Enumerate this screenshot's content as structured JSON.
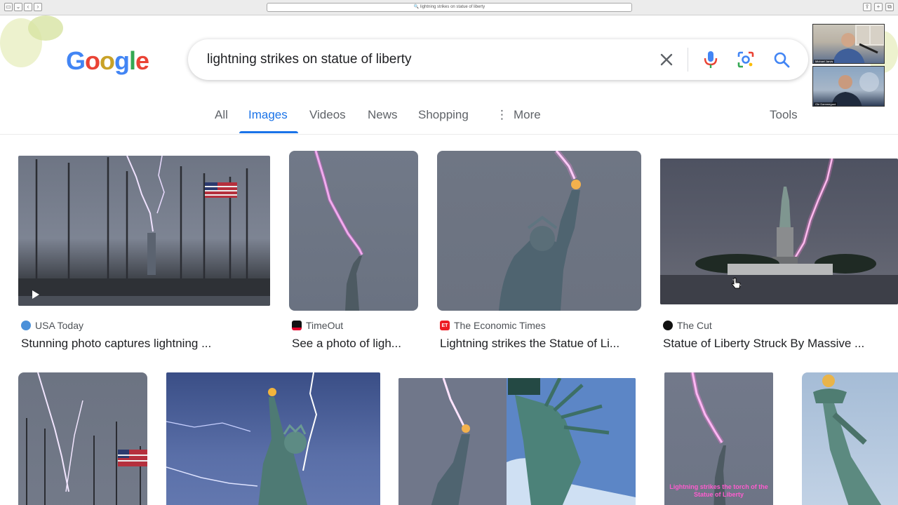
{
  "browser": {
    "address": "🔍 lightning strikes on statue of liberty"
  },
  "logo": {
    "letters": [
      "G",
      "o",
      "o",
      "g",
      "l",
      "e"
    ],
    "colors": [
      "#4285f4",
      "#ea4335",
      "#fbbc05",
      "#4285f4",
      "#34a853",
      "#ea4335"
    ]
  },
  "search": {
    "query": "lightning strikes on statue of liberty"
  },
  "tabs": [
    {
      "label": "All"
    },
    {
      "label": "Images"
    },
    {
      "label": "Videos"
    },
    {
      "label": "News"
    },
    {
      "label": "Shopping"
    },
    {
      "label": "More"
    }
  ],
  "tools_label": "Tools",
  "webcam": {
    "top_name": "Michael Jarvis",
    "bottom_name": "Ole Dammegard"
  },
  "results": [
    {
      "source": "USA Today",
      "title": "Stunning photo captures lightning ...",
      "favicon_color": "#4a90d9"
    },
    {
      "source": "TimeOut",
      "title": "See a photo of ligh...",
      "favicon_color": "#e4002b"
    },
    {
      "source": "The Economic Times",
      "title": "Lightning strikes the Statue of Li...",
      "favicon_color": "#ed1c24",
      "favicon_text": "ET"
    },
    {
      "source": "The Cut",
      "title": "Statue of Liberty Struck By Massive ...",
      "favicon_color": "#111111"
    }
  ],
  "row2_caption": "Lightning strikes the torch of the Statue of Liberty"
}
